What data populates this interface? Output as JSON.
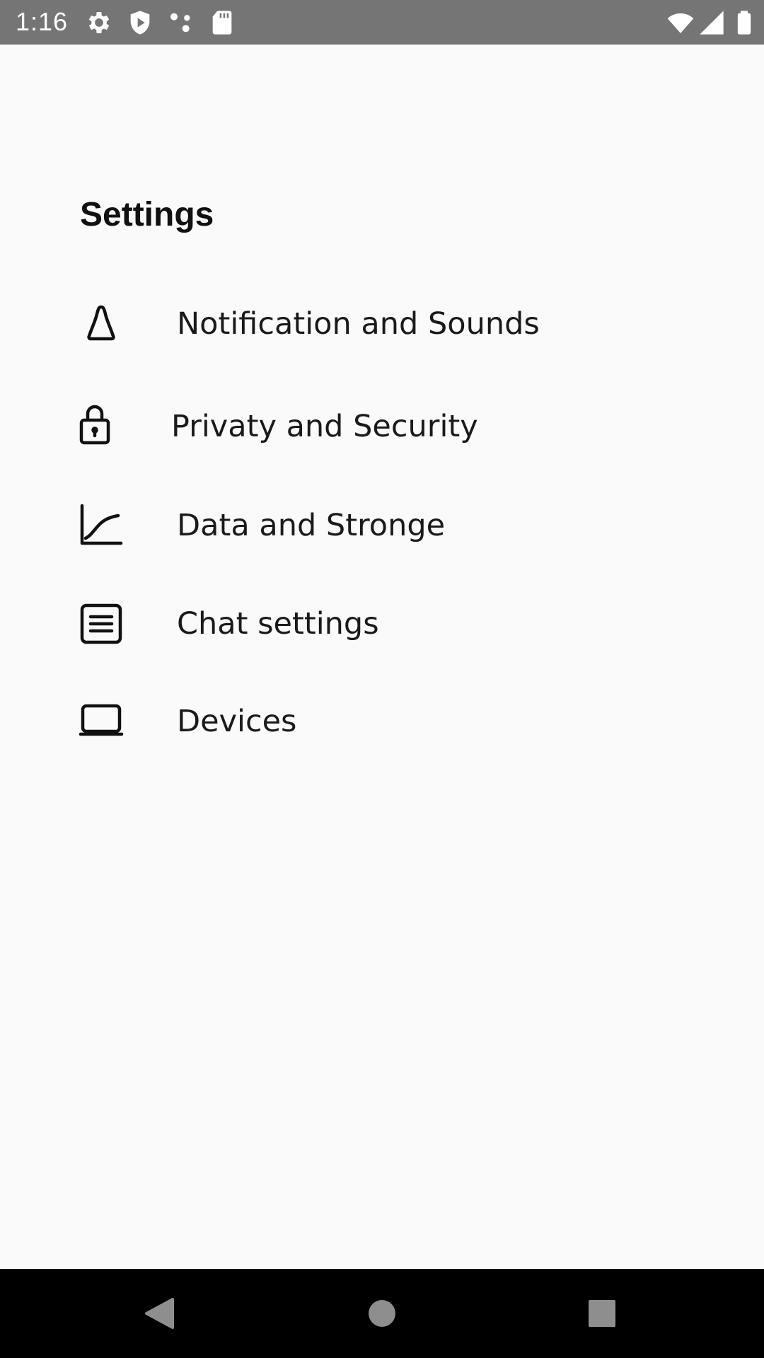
{
  "status_bar": {
    "time": "1:16",
    "left_icons": [
      "settings-gear-icon",
      "shield-icon",
      "dots-icon",
      "sd-card-icon"
    ],
    "right_icons": [
      "wifi-icon",
      "signal-icon",
      "battery-icon"
    ]
  },
  "header": {
    "title": "Settings"
  },
  "settings": {
    "items": [
      {
        "label": "Notification and Sounds",
        "icon": "bell-icon"
      },
      {
        "label": "Privaty and Security",
        "icon": "lock-icon"
      },
      {
        "label": "Data and Stronge",
        "icon": "chart-icon"
      },
      {
        "label": "Chat settings",
        "icon": "chat-list-icon"
      },
      {
        "label": "Devices",
        "icon": "laptop-icon"
      }
    ]
  },
  "nav_bar": {
    "buttons": [
      "back-icon",
      "home-icon",
      "recents-icon"
    ]
  },
  "colors": {
    "status_bar": "#757575",
    "background": "#fafafa",
    "text": "#1a1a1a",
    "nav_bar": "#000000"
  }
}
